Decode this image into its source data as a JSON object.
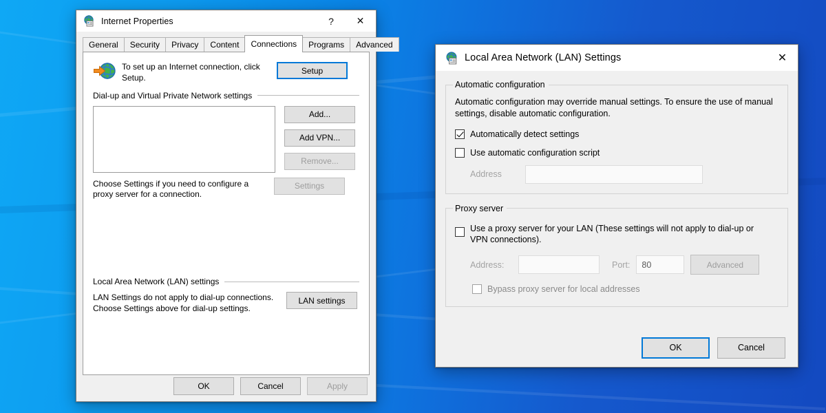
{
  "desktop": {
    "wallpaper_name": "windows-blue-wallpaper"
  },
  "internet_properties": {
    "title": "Internet Properties",
    "title_icon": "globe-properties-icon",
    "help_button": "?",
    "close_button": "✕",
    "tabs": [
      {
        "label": "General",
        "active": false
      },
      {
        "label": "Security",
        "active": false
      },
      {
        "label": "Privacy",
        "active": false
      },
      {
        "label": "Content",
        "active": false
      },
      {
        "label": "Connections",
        "active": true
      },
      {
        "label": "Programs",
        "active": false
      },
      {
        "label": "Advanced",
        "active": false
      }
    ],
    "setup": {
      "icon": "globe-arrow-icon",
      "text": "To set up an Internet connection, click Setup.",
      "button_label": "Setup"
    },
    "dialup_group": {
      "header": "Dial-up and Virtual Private Network settings",
      "list_items": [],
      "buttons": [
        {
          "label": "Add...",
          "disabled": false
        },
        {
          "label": "Add VPN...",
          "disabled": false
        },
        {
          "label": "Remove...",
          "disabled": true
        }
      ],
      "settings_button": {
        "label": "Settings",
        "disabled": true
      },
      "hint": "Choose Settings if you need to configure a proxy server for a connection."
    },
    "lan_group": {
      "header": "Local Area Network (LAN) settings",
      "text": "LAN Settings do not apply to dial-up connections. Choose Settings above for dial-up settings.",
      "button_label": "LAN settings"
    },
    "footer": {
      "ok": "OK",
      "cancel": "Cancel",
      "apply": "Apply",
      "apply_disabled": true
    }
  },
  "lan_settings": {
    "title": "Local Area Network (LAN) Settings",
    "title_icon": "globe-properties-icon",
    "close_button": "✕",
    "automatic_configuration": {
      "legend": "Automatic configuration",
      "description": "Automatic configuration may override manual settings.  To ensure the use of manual settings, disable automatic configuration.",
      "auto_detect": {
        "label": "Automatically detect settings",
        "checked": true
      },
      "use_script": {
        "label": "Use automatic configuration script",
        "checked": false
      },
      "address_label": "Address",
      "address_value": "",
      "address_placeholder": ""
    },
    "proxy_server": {
      "legend": "Proxy server",
      "use_proxy": {
        "label": "Use a proxy server for your LAN (These settings will not apply to dial-up or VPN connections).",
        "checked": false
      },
      "address_label": "Address:",
      "address_value": "",
      "port_label": "Port:",
      "port_value": "80",
      "advanced_button": {
        "label": "Advanced",
        "disabled": true
      },
      "bypass": {
        "label": "Bypass proxy server for local addresses",
        "checked": false
      }
    },
    "footer": {
      "ok": "OK",
      "cancel": "Cancel"
    }
  },
  "colors": {
    "accent": "#0078d7",
    "window_face": "#f0f0f0",
    "button_face": "#e1e1e1",
    "disabled_text": "#9d9d9d",
    "wallpaper_left": "#0fa8f5",
    "wallpaper_right": "#1349c0"
  }
}
